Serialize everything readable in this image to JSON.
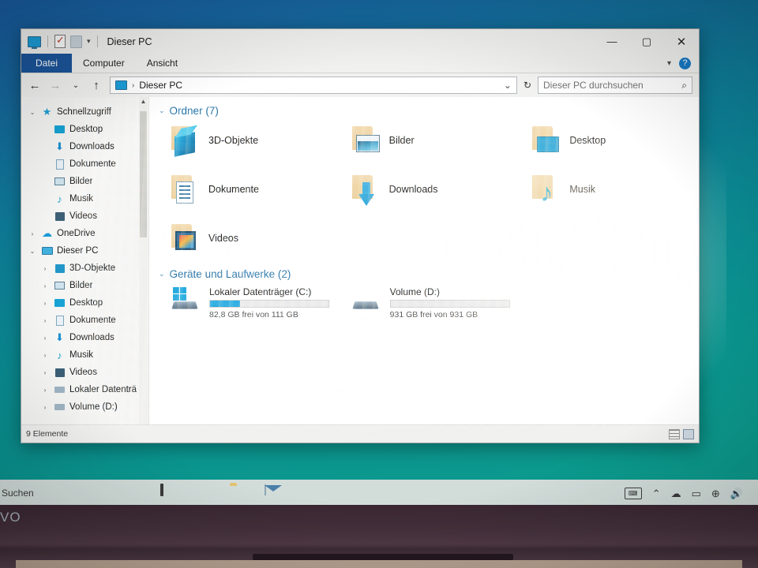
{
  "window": {
    "title": "Dieser PC",
    "quick_access_icons": [
      "pc-icon",
      "properties-icon",
      "new-folder-icon",
      "customize-chevron-icon"
    ],
    "controls": {
      "minimize": "—",
      "maximize": "▢",
      "close": "✕"
    }
  },
  "ribbon": {
    "tabs": [
      {
        "label": "Datei",
        "selected": true
      },
      {
        "label": "Computer",
        "selected": false
      },
      {
        "label": "Ansicht",
        "selected": false
      }
    ],
    "collapse_icon": "chevron-down-icon",
    "help_icon": "help-icon",
    "help_glyph": "?"
  },
  "address": {
    "back_glyph": "←",
    "forward_glyph": "→",
    "recent_glyph": "⌄",
    "up_glyph": "↑",
    "path_icon": "pc-icon",
    "separator": "›",
    "path": "Dieser PC",
    "dropdown_glyph": "⌄",
    "refresh_glyph": "↻"
  },
  "search": {
    "placeholder": "Dieser PC durchsuchen",
    "value": "",
    "icon": "search-icon",
    "icon_glyph": "⌕"
  },
  "navpane": {
    "items": [
      {
        "label": "Schnellzugriff",
        "icon": "star-icon",
        "indent": 0,
        "twisty": "⌄",
        "pinned": false
      },
      {
        "label": "Desktop",
        "icon": "desktop-icon",
        "indent": 1,
        "twisty": "",
        "pinned": true
      },
      {
        "label": "Downloads",
        "icon": "download-icon",
        "indent": 1,
        "twisty": "",
        "pinned": true
      },
      {
        "label": "Dokumente",
        "icon": "document-icon",
        "indent": 1,
        "twisty": "",
        "pinned": true
      },
      {
        "label": "Bilder",
        "icon": "picture-icon",
        "indent": 1,
        "twisty": "",
        "pinned": true
      },
      {
        "label": "Musik",
        "icon": "music-icon",
        "indent": 1,
        "twisty": "",
        "pinned": false
      },
      {
        "label": "Videos",
        "icon": "video-icon",
        "indent": 1,
        "twisty": "",
        "pinned": false
      },
      {
        "label": "OneDrive",
        "icon": "cloud-icon",
        "indent": 0,
        "twisty": "›",
        "pinned": false
      },
      {
        "label": "Dieser PC",
        "icon": "pc-icon",
        "indent": 0,
        "twisty": "⌄",
        "pinned": false
      },
      {
        "label": "3D-Objekte",
        "icon": "3d-icon",
        "indent": 1,
        "twisty": "›",
        "pinned": false
      },
      {
        "label": "Bilder",
        "icon": "picture-icon",
        "indent": 1,
        "twisty": "›",
        "pinned": false
      },
      {
        "label": "Desktop",
        "icon": "desktop-icon",
        "indent": 1,
        "twisty": "›",
        "pinned": false
      },
      {
        "label": "Dokumente",
        "icon": "document-icon",
        "indent": 1,
        "twisty": "›",
        "pinned": false
      },
      {
        "label": "Downloads",
        "icon": "download-icon",
        "indent": 1,
        "twisty": "›",
        "pinned": false
      },
      {
        "label": "Musik",
        "icon": "music-icon",
        "indent": 1,
        "twisty": "›",
        "pinned": false
      },
      {
        "label": "Videos",
        "icon": "video-icon",
        "indent": 1,
        "twisty": "›",
        "pinned": false
      },
      {
        "label": "Lokaler Datenträ",
        "icon": "drive-icon",
        "indent": 1,
        "twisty": "›",
        "pinned": false
      },
      {
        "label": "Volume (D:)",
        "icon": "drive-icon",
        "indent": 1,
        "twisty": "›",
        "pinned": false
      }
    ]
  },
  "content": {
    "folders_group": {
      "label": "Ordner (7)",
      "twisty": "⌄"
    },
    "folders": [
      {
        "label": "3D-Objekte",
        "icon": "3d-objects-folder-icon"
      },
      {
        "label": "Bilder",
        "icon": "pictures-folder-icon"
      },
      {
        "label": "Desktop",
        "icon": "desktop-folder-icon"
      },
      {
        "label": "Dokumente",
        "icon": "documents-folder-icon"
      },
      {
        "label": "Downloads",
        "icon": "downloads-folder-icon"
      },
      {
        "label": "Musik",
        "icon": "music-folder-icon"
      },
      {
        "label": "Videos",
        "icon": "videos-folder-icon"
      }
    ],
    "drives_group": {
      "label": "Geräte und Laufwerke (2)",
      "twisty": "⌄"
    },
    "drives": [
      {
        "name": "Lokaler Datenträger (C:)",
        "free_text": "82,8 GB frei von 111 GB",
        "used_percent": 25,
        "icon": "windows-drive-icon"
      },
      {
        "name": "Volume (D:)",
        "free_text": "931 GB frei von 931 GB",
        "used_percent": 0,
        "icon": "hdd-icon"
      }
    ]
  },
  "statusbar": {
    "item_count": "9 Elemente",
    "view_details_icon": "details-view-icon",
    "view_icons_icon": "large-icons-view-icon"
  },
  "taskbar": {
    "search_text": "Suchen",
    "items": [
      {
        "name": "task-view",
        "icon": "task-view-icon"
      },
      {
        "name": "edge",
        "icon": "edge-icon"
      },
      {
        "name": "file-explorer",
        "icon": "file-explorer-icon"
      },
      {
        "name": "mail",
        "icon": "mail-icon"
      }
    ],
    "tray": {
      "keyboard_glyph": "⌨",
      "overflow_glyph": "⌃",
      "onedrive_glyph": "☁",
      "battery_glyph": "▭",
      "network_glyph": "⊕",
      "volume_glyph": "🔊",
      "clock_line1": "",
      "clock_line2": ""
    }
  },
  "laptop": {
    "brand": "VO"
  },
  "colors": {
    "accent": "#1b559b",
    "drive_bar": "#1ea8e0",
    "group_header": "#1c6ea4",
    "desktop_top": "#1a5ea4",
    "desktop_bottom": "#0d9c8c"
  }
}
